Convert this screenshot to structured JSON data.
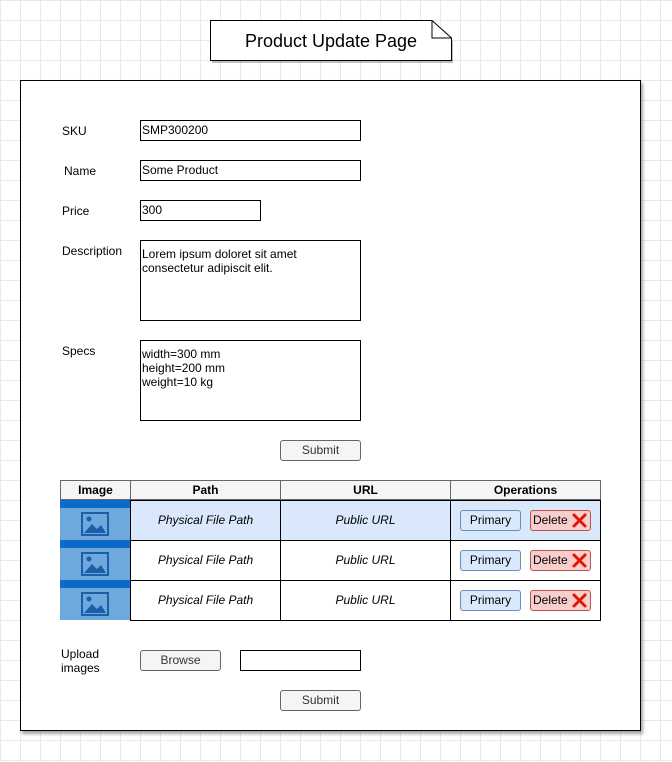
{
  "page": {
    "title": "Product Update Page"
  },
  "form": {
    "sku_label": "SKU",
    "sku_value": "SMP300200",
    "name_label": "Name",
    "name_value": "Some Product",
    "price_label": "Price",
    "price_value": "300",
    "description_label": "Description",
    "description_value": "Lorem ipsum doloret sit amet\nconsectetur adipiscit elit.",
    "specs_label": "Specs",
    "specs_value": "width=300 mm\nheight=200 mm\nweight=10 kg",
    "submit_label": "Submit"
  },
  "images_table": {
    "columns": [
      "Image",
      "Path",
      "URL",
      "Operations"
    ],
    "rows": [
      {
        "path": "Physical File Path",
        "url": "Public URL",
        "primary_label": "Primary",
        "delete_label": "Delete",
        "highlighted": true
      },
      {
        "path": "Physical File Path",
        "url": "Public URL",
        "primary_label": "Primary",
        "delete_label": "Delete",
        "highlighted": false
      },
      {
        "path": "Physical File Path",
        "url": "Public URL",
        "primary_label": "Primary",
        "delete_label": "Delete",
        "highlighted": false
      }
    ]
  },
  "upload": {
    "label": "Upload\nimages",
    "browse_label": "Browse",
    "file_value": "",
    "submit_label": "Submit"
  },
  "colors": {
    "grid": "#e9e9e9",
    "highlight_row": "#dae8fc",
    "image_placeholder": "#6fa8dc",
    "primary_button": "#dae8fc",
    "delete_button": "#f8cecc",
    "delete_icon": "#e51400"
  }
}
